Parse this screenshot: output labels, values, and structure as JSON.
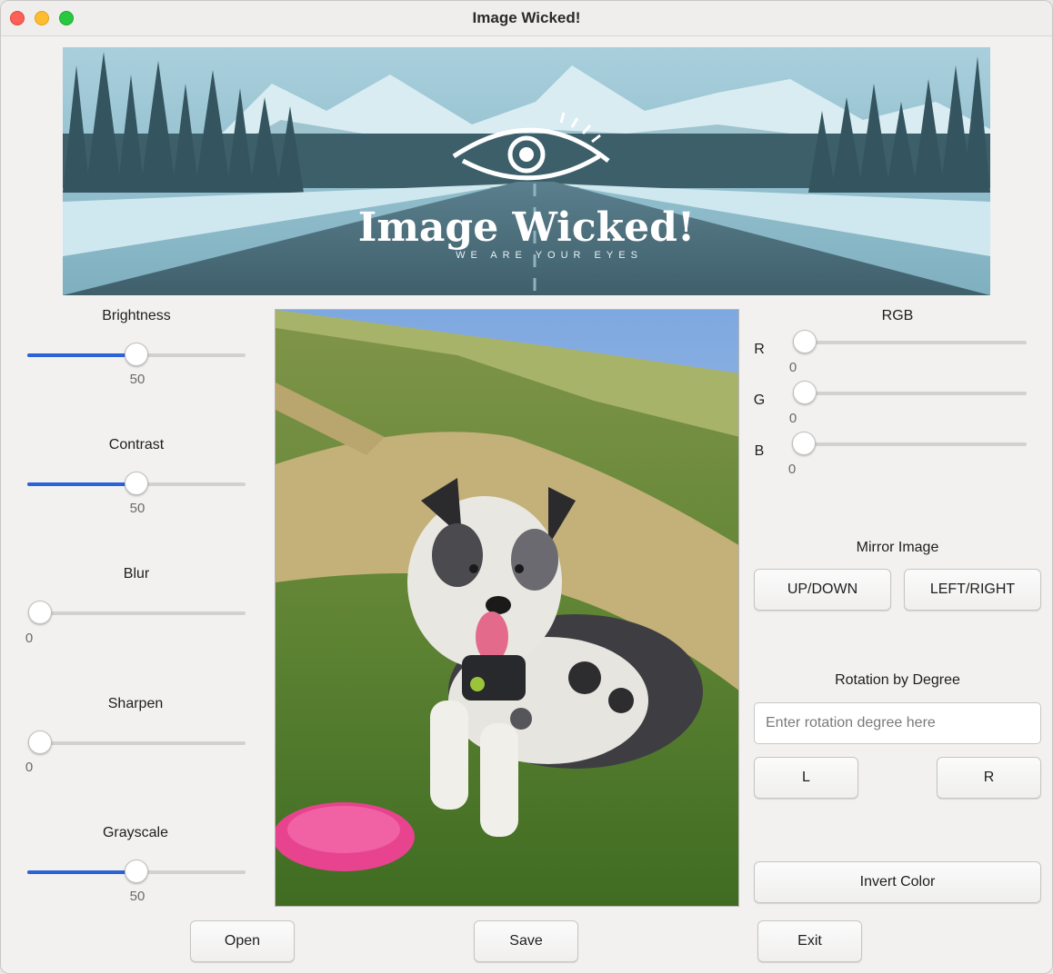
{
  "window": {
    "title": "Image Wicked!"
  },
  "banner": {
    "title": "Image Wicked!",
    "tagline": "WE ARE YOUR EYES"
  },
  "adjustments": [
    {
      "label": "Brightness",
      "value": "50",
      "level": 50
    },
    {
      "label": "Contrast",
      "value": "50",
      "level": 50
    },
    {
      "label": "Blur",
      "value": "0",
      "level": 0
    },
    {
      "label": "Sharpen",
      "value": "0",
      "level": 0
    },
    {
      "label": "Grayscale",
      "value": "50",
      "level": 50
    }
  ],
  "rgb": {
    "title": "RGB",
    "channels": [
      {
        "label": "R",
        "value": "0",
        "level": 0
      },
      {
        "label": "G",
        "value": "0",
        "level": 0
      },
      {
        "label": "B",
        "value": "0",
        "level": 0
      }
    ]
  },
  "mirror": {
    "title": "Mirror Image",
    "up_down": "UP/DOWN",
    "left_right": "LEFT/RIGHT"
  },
  "rotation": {
    "title": "Rotation by Degree",
    "placeholder": "Enter rotation degree here",
    "left": "L",
    "right": "R"
  },
  "invert_label": "Invert Color",
  "bottom": {
    "open": "Open",
    "save": "Save",
    "exit": "Exit"
  },
  "colors": {
    "slider_fill": "#2a62d8",
    "frisbee": "#e8438f"
  }
}
